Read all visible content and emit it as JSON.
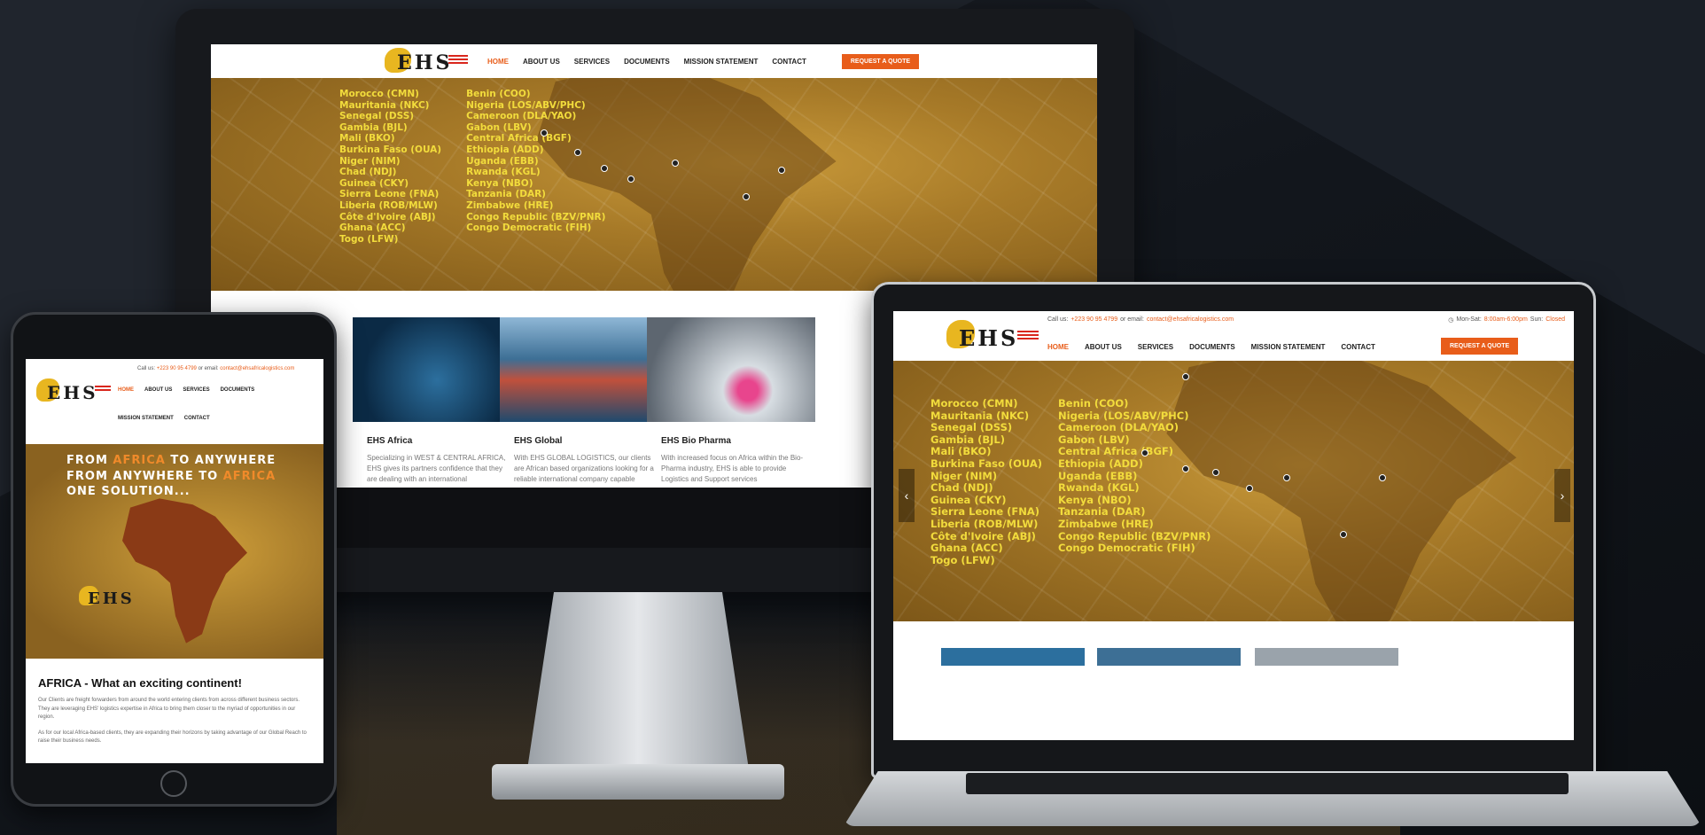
{
  "brand": {
    "logo_text": "EHS",
    "accent": "#e85d1a",
    "country_text_color": "#f2dc3c"
  },
  "nav": {
    "items": [
      "HOME",
      "ABOUT US",
      "SERVICES",
      "DOCUMENTS",
      "MISSION STATEMENT",
      "CONTACT"
    ],
    "cta": "REQUEST A QUOTE"
  },
  "contact": {
    "call_label": "Call us:",
    "phone": "+223 90 95 4799",
    "email_label": "or email:",
    "email": "contact@ehsafricalogistics.com",
    "hours_label": "Mon-Sat:",
    "hours": "8:00am-6:00pm",
    "sun_label": "Sun:",
    "sun": "Closed"
  },
  "countries": {
    "col1": [
      "Morocco (CMN)",
      "Mauritania (NKC)",
      "Senegal (DSS)",
      "Gambia (BJL)",
      "Mali (BKO)",
      "Burkina Faso (OUA)",
      "Niger (NIM)",
      "Chad (NDJ)",
      "Guinea (CKY)",
      "Sierra Leone (FNA)",
      "Liberia (ROB/MLW)",
      "Côte d'Ivoire (ABJ)",
      "Ghana (ACC)",
      "Togo (LFW)"
    ],
    "col2": [
      "Benin (COO)",
      "Nigeria (LOS/ABV/PHC)",
      "Cameroon (DLA/YAO)",
      "Gabon (LBV)",
      "Central Africa (BGF)",
      "Ethiopia (ADD)",
      "Uganda (EBB)",
      "Rwanda (KGL)",
      "Kenya (NBO)",
      "Tanzania (DAR)",
      "Zimbabwe (HRE)",
      "Congo Republic (BZV/PNR)",
      "Congo Democratic (FIH)"
    ]
  },
  "cards": [
    {
      "title": "EHS Africa",
      "desc": "Specializing in WEST & CENTRAL AFRICA, EHS gives its partners confidence that they are dealing with an international"
    },
    {
      "title": "EHS Global",
      "desc": "With EHS GLOBAL LOGISTICS, our clients are African based organizations looking for a reliable international company capable"
    },
    {
      "title": "EHS Bio Pharma",
      "desc": "With increased focus on Africa within the Bio-Pharma industry, EHS is able to provide Logistics and Support services"
    }
  ],
  "tablet": {
    "tagline": [
      "FROM ",
      "AFRICA",
      " TO ANYWHERE",
      "FROM ANYWHERE TO ",
      "AFRICA",
      "ONE SOLUTION..."
    ],
    "heading": "AFRICA - What an exciting continent!",
    "para1": "Our Clients are freight forwarders from around the world entering clients from across different business sectors. They are leveraging EHS' logistics expertise in Africa to bring them closer to the myriad of opportunities in our region.",
    "para2": "As for our local Africa-based clients, they are expanding their horizons by taking advantage of our Global Reach to raise their business needs."
  },
  "icons": {
    "prev": "chevron-left-icon",
    "next": "chevron-right-icon",
    "clock": "clock-icon"
  }
}
